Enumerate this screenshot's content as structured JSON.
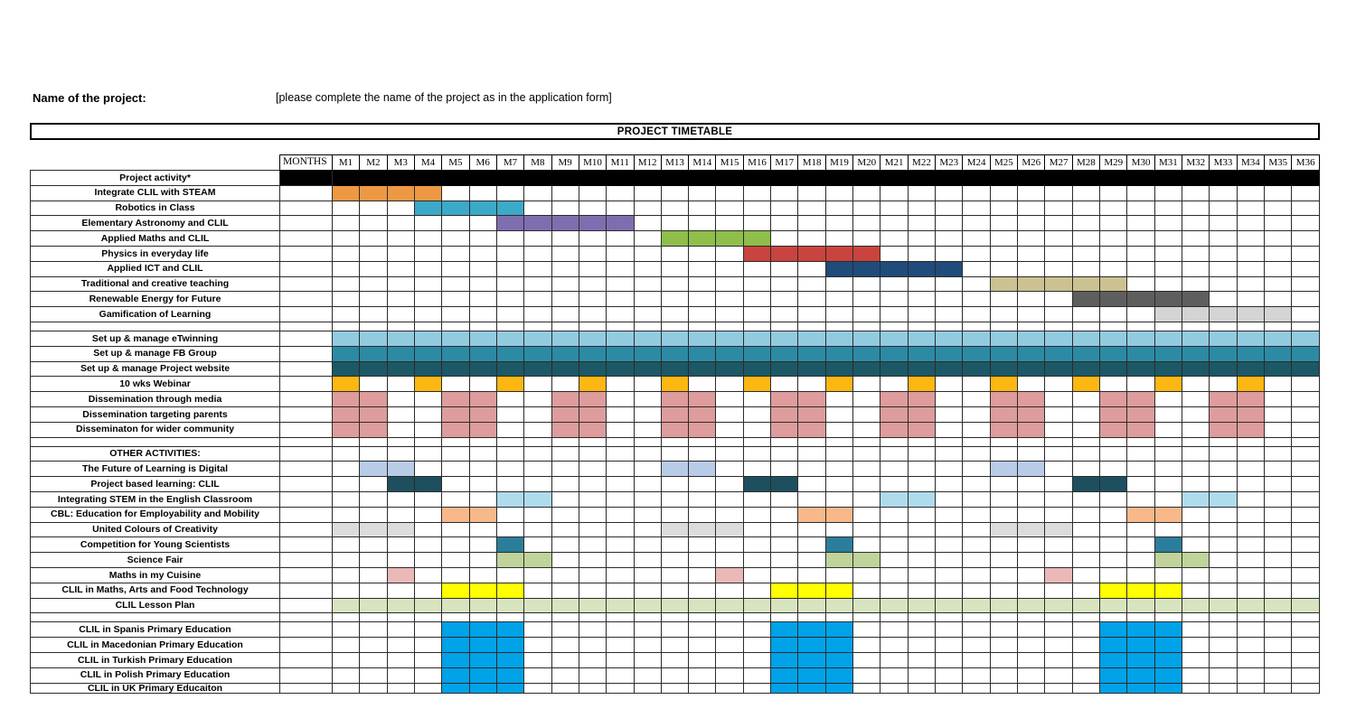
{
  "header": {
    "project_name_label": "Name of the project:",
    "project_name_value": "[please complete the name of the project as in the application form]",
    "banner_title": "PROJECT TIMETABLE"
  },
  "table": {
    "months_label": "MONTHS",
    "months": [
      "M1",
      "M2",
      "M3",
      "M4",
      "M5",
      "M6",
      "M7",
      "M8",
      "M9",
      "M10",
      "M11",
      "M12",
      "M13",
      "M14",
      "M15",
      "M16",
      "M17",
      "M18",
      "M19",
      "M20",
      "M21",
      "M22",
      "M23",
      "M24",
      "M25",
      "M26",
      "M27",
      "M28",
      "M29",
      "M30",
      "M31",
      "M32",
      "M33",
      "M34",
      "M35",
      "M36"
    ],
    "activity_header": "Project activity*"
  },
  "colors": {
    "orange": "#ED9843",
    "cyan": "#3BA9C8",
    "purple": "#7F6EAF",
    "green": "#8FBE4B",
    "red": "#C9443E",
    "navy": "#1F4C7A",
    "khaki": "#CCC291",
    "darkgrey": "#5E5E5E",
    "lightgrey": "#D4D4D4",
    "skyblue": "#92CBE0",
    "teal": "#2B8BA5",
    "darkteal": "#1C5866",
    "amber": "#FCB712",
    "salmon": "#DE9C9C",
    "paleblue": "#B9CCE7",
    "deepteal": "#1E4F5E",
    "paleskyblue": "#AEDCED",
    "peach": "#F8B98A",
    "palegrey": "#DCDCDC",
    "midteal": "#2B7E9B",
    "palegreen": "#BFD39A",
    "palepink": "#EBB8B8",
    "yellow": "#FFFF00",
    "verypalegreen": "#D8E4C0",
    "brightblue": "#00A2E8",
    "black": "#000000",
    "white": "#FFFFFF"
  },
  "chart_data": {
    "type": "bar",
    "title": "PROJECT TIMETABLE",
    "xlabel": "MONTHS",
    "ylabel": "Project activity*",
    "categories": [
      "M1",
      "M2",
      "M3",
      "M4",
      "M5",
      "M6",
      "M7",
      "M8",
      "M9",
      "M10",
      "M11",
      "M12",
      "M13",
      "M14",
      "M15",
      "M16",
      "M17",
      "M18",
      "M19",
      "M20",
      "M21",
      "M22",
      "M23",
      "M24",
      "M25",
      "M26",
      "M27",
      "M28",
      "M29",
      "M30",
      "M31",
      "M32",
      "M33",
      "M34",
      "M35",
      "M36"
    ],
    "rows": [
      {
        "label": "Integrate CLIL with STEAM",
        "type": "activity",
        "color": "orange",
        "spans": [
          [
            1,
            4
          ]
        ]
      },
      {
        "label": "Robotics in Class",
        "type": "activity",
        "color": "cyan",
        "spans": [
          [
            4,
            7
          ]
        ]
      },
      {
        "label": "Elementary Astronomy and CLIL",
        "type": "activity",
        "color": "purple",
        "spans": [
          [
            7,
            11
          ]
        ]
      },
      {
        "label": "Applied Maths and CLIL",
        "type": "activity",
        "color": "green",
        "spans": [
          [
            13,
            16
          ]
        ]
      },
      {
        "label": "Physics in everyday life",
        "type": "activity",
        "color": "red",
        "spans": [
          [
            16,
            20
          ]
        ]
      },
      {
        "label": "Applied ICT and CLIL",
        "type": "activity",
        "color": "navy",
        "spans": [
          [
            19,
            23
          ]
        ]
      },
      {
        "label": "Traditional and creative teaching",
        "type": "activity",
        "color": "khaki",
        "spans": [
          [
            25,
            29
          ]
        ]
      },
      {
        "label": "Renewable Energy for Future",
        "type": "activity",
        "color": "darkgrey",
        "spans": [
          [
            28,
            32
          ]
        ]
      },
      {
        "label": "Gamification of Learning",
        "type": "activity",
        "color": "lightgrey",
        "spans": [
          [
            31,
            35
          ]
        ]
      },
      {
        "label": "",
        "type": "spacer",
        "color": null,
        "spans": []
      },
      {
        "label": "Set up & manage eTwinning",
        "type": "activity",
        "color": "skyblue",
        "spans": [
          [
            1,
            36
          ]
        ]
      },
      {
        "label": "Set up & manage FB Group",
        "type": "activity",
        "color": "teal",
        "spans": [
          [
            1,
            36
          ]
        ]
      },
      {
        "label": "Set up & manage Project website",
        "type": "activity",
        "color": "darkteal",
        "spans": [
          [
            1,
            36
          ]
        ]
      },
      {
        "label": "10 wks Webinar",
        "type": "activity",
        "color": "amber",
        "spans": [
          [
            1,
            1
          ],
          [
            4,
            4
          ],
          [
            7,
            7
          ],
          [
            10,
            10
          ],
          [
            13,
            13
          ],
          [
            16,
            16
          ],
          [
            19,
            19
          ],
          [
            22,
            22
          ],
          [
            25,
            25
          ],
          [
            28,
            28
          ],
          [
            31,
            31
          ],
          [
            34,
            34
          ]
        ]
      },
      {
        "label": "Dissemination through media",
        "type": "activity",
        "color": "salmon",
        "spans": [
          [
            1,
            2
          ],
          [
            5,
            6
          ],
          [
            9,
            10
          ],
          [
            13,
            14
          ],
          [
            17,
            18
          ],
          [
            21,
            22
          ],
          [
            25,
            26
          ],
          [
            29,
            30
          ],
          [
            33,
            34
          ]
        ]
      },
      {
        "label": "Dissemination targeting parents",
        "type": "activity",
        "color": "salmon",
        "spans": [
          [
            1,
            2
          ],
          [
            5,
            6
          ],
          [
            9,
            10
          ],
          [
            13,
            14
          ],
          [
            17,
            18
          ],
          [
            21,
            22
          ],
          [
            25,
            26
          ],
          [
            29,
            30
          ],
          [
            33,
            34
          ]
        ]
      },
      {
        "label": "Disseminaton for wider community",
        "type": "activity",
        "color": "salmon",
        "spans": [
          [
            1,
            2
          ],
          [
            5,
            6
          ],
          [
            9,
            10
          ],
          [
            13,
            14
          ],
          [
            17,
            18
          ],
          [
            21,
            22
          ],
          [
            25,
            26
          ],
          [
            29,
            30
          ],
          [
            33,
            34
          ]
        ]
      },
      {
        "label": "",
        "type": "spacer",
        "color": null,
        "spans": []
      },
      {
        "label": "OTHER ACTIVITIES:",
        "type": "section",
        "color": null,
        "spans": []
      },
      {
        "label": "The Future of Learning is Digital",
        "type": "activity",
        "color": "paleblue",
        "spans": [
          [
            2,
            3
          ],
          [
            13,
            14
          ],
          [
            25,
            26
          ]
        ]
      },
      {
        "label": "Project based learning: CLIL",
        "type": "activity",
        "color": "deepteal",
        "spans": [
          [
            3,
            4
          ],
          [
            16,
            17
          ],
          [
            28,
            29
          ]
        ]
      },
      {
        "label": "Integrating STEM in the English Classroom",
        "type": "activity",
        "color": "paleskyblue",
        "spans": [
          [
            7,
            8
          ],
          [
            21,
            22
          ],
          [
            32,
            33
          ]
        ]
      },
      {
        "label": "CBL: Education for Employability and Mobility",
        "type": "activity",
        "color": "peach",
        "spans": [
          [
            5,
            6
          ],
          [
            18,
            19
          ],
          [
            30,
            31
          ]
        ]
      },
      {
        "label": "United Colours of Creativity",
        "type": "activity",
        "color": "palegrey",
        "spans": [
          [
            1,
            3
          ],
          [
            13,
            15
          ],
          [
            25,
            27
          ]
        ]
      },
      {
        "label": "Competition for Young Scientists",
        "type": "activity",
        "color": "midteal",
        "spans": [
          [
            7,
            7
          ],
          [
            19,
            19
          ],
          [
            31,
            31
          ]
        ]
      },
      {
        "label": "Science Fair",
        "type": "activity",
        "color": "palegreen",
        "spans": [
          [
            7,
            8
          ],
          [
            19,
            20
          ],
          [
            31,
            32
          ]
        ]
      },
      {
        "label": "Maths in my Cuisine",
        "type": "activity",
        "color": "palepink",
        "spans": [
          [
            3,
            3
          ],
          [
            15,
            15
          ],
          [
            27,
            27
          ]
        ]
      },
      {
        "label": "CLIL in Maths, Arts and Food Technology",
        "type": "activity",
        "color": "yellow",
        "spans": [
          [
            5,
            7
          ],
          [
            17,
            19
          ],
          [
            29,
            31
          ]
        ]
      },
      {
        "label": "CLIL Lesson Plan",
        "type": "activity",
        "color": "verypalegreen",
        "spans": [
          [
            1,
            36
          ]
        ]
      },
      {
        "label": "",
        "type": "spacer",
        "color": null,
        "spans": []
      },
      {
        "label": "CLIL in Spanis Primary Education",
        "type": "activity",
        "color": "brightblue",
        "spans": [
          [
            5,
            7
          ],
          [
            17,
            19
          ],
          [
            29,
            31
          ]
        ]
      },
      {
        "label": "CLIL in Macedonian Primary Education",
        "type": "activity",
        "color": "brightblue",
        "spans": [
          [
            5,
            7
          ],
          [
            17,
            19
          ],
          [
            29,
            31
          ]
        ]
      },
      {
        "label": "CLIL in Turkish Primary Education",
        "type": "activity",
        "color": "brightblue",
        "spans": [
          [
            5,
            7
          ],
          [
            17,
            19
          ],
          [
            29,
            31
          ]
        ]
      },
      {
        "label": "CLIL in Polish Primary Education",
        "type": "activity",
        "color": "brightblue",
        "spans": [
          [
            5,
            7
          ],
          [
            17,
            19
          ],
          [
            29,
            31
          ]
        ]
      },
      {
        "label": "CLIL in UK Primary Educaiton",
        "type": "cut",
        "color": "brightblue",
        "spans": [
          [
            5,
            7
          ],
          [
            17,
            19
          ],
          [
            29,
            31
          ]
        ]
      }
    ]
  }
}
